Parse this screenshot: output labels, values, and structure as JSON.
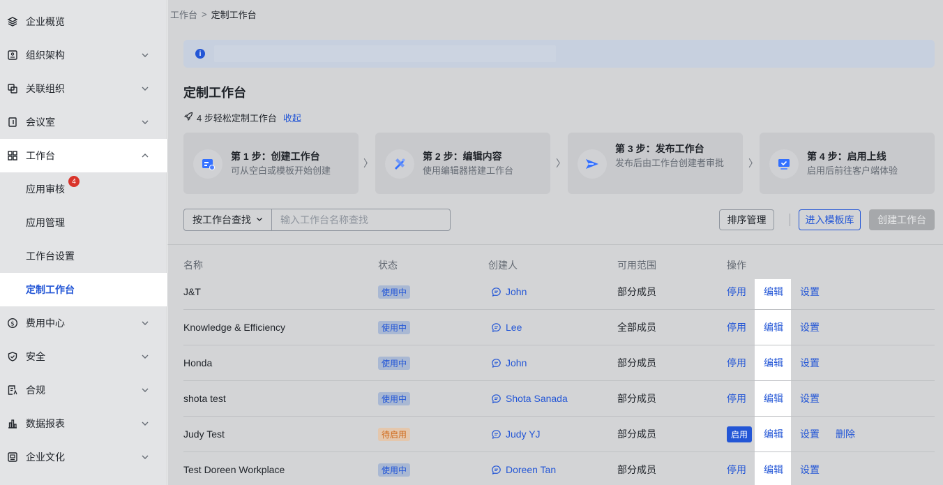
{
  "sidebar": {
    "items": [
      {
        "label": "企业概览",
        "icon": "layers-icon"
      },
      {
        "label": "组织架构",
        "icon": "org-icon"
      },
      {
        "label": "关联组织",
        "icon": "link-org-icon"
      },
      {
        "label": "会议室",
        "icon": "door-icon"
      },
      {
        "label": "工作台",
        "icon": "grid-icon"
      },
      {
        "label": "费用中心",
        "icon": "dollar-icon"
      },
      {
        "label": "安全",
        "icon": "shield-icon"
      },
      {
        "label": "合规",
        "icon": "compliance-icon"
      },
      {
        "label": "数据报表",
        "icon": "chart-icon"
      },
      {
        "label": "企业文化",
        "icon": "culture-icon"
      }
    ],
    "sub_items": [
      {
        "label": "应用审核",
        "badge": "4"
      },
      {
        "label": "应用管理"
      },
      {
        "label": "工作台设置"
      },
      {
        "label": "定制工作台"
      }
    ]
  },
  "breadcrumb": {
    "parent": "工作台",
    "sep": ">",
    "current": "定制工作台"
  },
  "page_title": "定制工作台",
  "steps_header": {
    "text": "4 步轻松定制工作台",
    "toggle": "收起"
  },
  "steps": [
    {
      "title": "第 1 步：创建工作台",
      "desc": "可从空白或模板开始创建"
    },
    {
      "title": "第 2 步：编辑内容",
      "desc": "使用编辑器搭建工作台"
    },
    {
      "title": "第 3 步：发布工作台",
      "desc": "发布后由工作台创建者审批"
    },
    {
      "title": "第 4 步：启用上线",
      "desc": "启用后前往客户端体验"
    }
  ],
  "step_sep": "〉",
  "filter": {
    "select": "按工作台查找",
    "placeholder": "输入工作台名称查找"
  },
  "buttons": {
    "sort": "排序管理",
    "template": "进入模板库",
    "create": "创建工作台"
  },
  "table": {
    "headers": [
      "名称",
      "状态",
      "创建人",
      "可用范围",
      "操作"
    ],
    "rows": [
      {
        "name": "J&T",
        "status": "使用中",
        "creator": "John",
        "scope": "部分成员",
        "ops": [
          "停用",
          "编辑",
          "设置"
        ]
      },
      {
        "name": "Knowledge & Efficiency",
        "status": "使用中",
        "creator": "Lee",
        "scope": "全部成员",
        "ops": [
          "停用",
          "编辑",
          "设置"
        ]
      },
      {
        "name": "Honda",
        "status": "使用中",
        "creator": "John",
        "scope": "部分成员",
        "ops": [
          "停用",
          "编辑",
          "设置"
        ]
      },
      {
        "name": "shota test",
        "status": "使用中",
        "creator": "Shota Sanada",
        "scope": "部分成员",
        "ops": [
          "停用",
          "编辑",
          "设置"
        ]
      },
      {
        "name": "Judy Test",
        "status": "待启用",
        "creator": "Judy YJ",
        "scope": "部分成员",
        "ops": [
          "启用",
          "编辑",
          "设置",
          "删除"
        ]
      },
      {
        "name": "Test Doreen Workplace",
        "status": "使用中",
        "creator": "Doreen Tan",
        "scope": "部分成员",
        "ops": [
          "停用",
          "编辑",
          "设置"
        ]
      }
    ]
  },
  "colors": {
    "accent": "#2356d6",
    "badge": "#d9342b",
    "pending": "#d06a1a"
  }
}
